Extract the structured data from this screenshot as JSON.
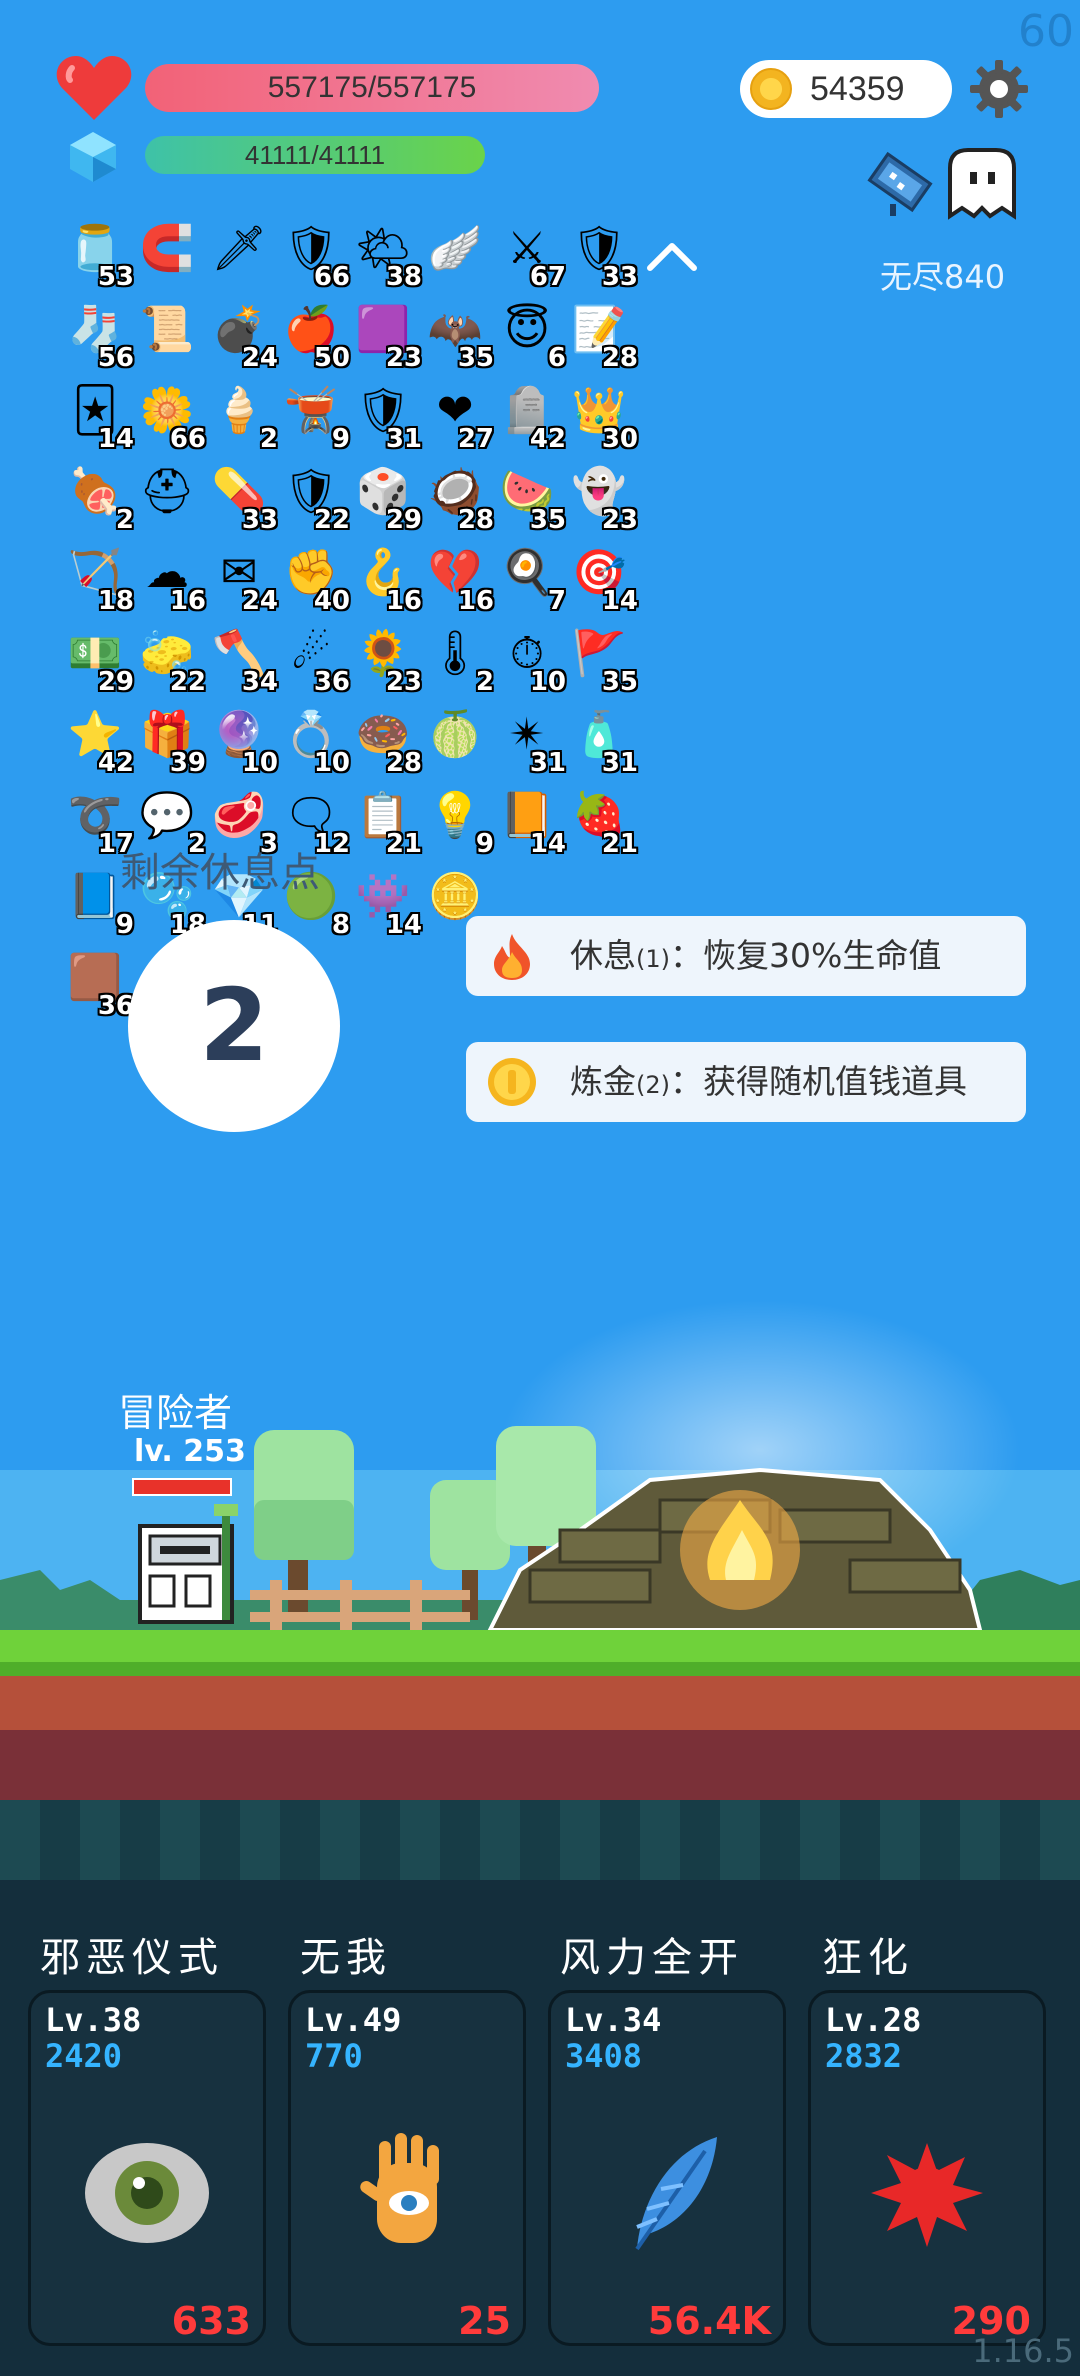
{
  "fps": "60",
  "version": "1.16.5",
  "hp": {
    "text": "557175/557175",
    "fraction": 1.0
  },
  "mp": {
    "text": "41111/41111",
    "fraction": 1.0
  },
  "gold": "54359",
  "endless_label": "无尽840",
  "items": [
    {
      "icon": "jar-icon",
      "glyph": "🫙",
      "count": "53"
    },
    {
      "icon": "magnet-icon",
      "glyph": "🧲",
      "count": ""
    },
    {
      "icon": "sword-icon",
      "glyph": "🗡",
      "count": ""
    },
    {
      "icon": "round-shield-icon",
      "glyph": "🛡",
      "count": "66"
    },
    {
      "icon": "sun-icon",
      "glyph": "🌤",
      "count": "38"
    },
    {
      "icon": "wing-icon",
      "glyph": "🪽",
      "count": ""
    },
    {
      "icon": "long-sword-icon",
      "glyph": "⚔",
      "count": "67"
    },
    {
      "icon": "shield-icon",
      "glyph": "🛡",
      "count": "33"
    },
    {
      "icon": "sock-icon",
      "glyph": "🧦",
      "count": "56"
    },
    {
      "icon": "scroll-icon",
      "glyph": "📜",
      "count": ""
    },
    {
      "icon": "grenade-icon",
      "glyph": "💣",
      "count": "24"
    },
    {
      "icon": "apple-icon",
      "glyph": "🍎",
      "count": "50"
    },
    {
      "icon": "purple-box-icon",
      "glyph": "🟪",
      "count": "23"
    },
    {
      "icon": "bat-icon",
      "glyph": "🦇",
      "count": "35"
    },
    {
      "icon": "halo-icon",
      "glyph": "😇",
      "count": "6"
    },
    {
      "icon": "note-icon",
      "glyph": "📝",
      "count": "28"
    },
    {
      "icon": "playing-cards-icon",
      "glyph": "🃏",
      "count": "14"
    },
    {
      "icon": "flower-icon",
      "glyph": "🌼",
      "count": "66"
    },
    {
      "icon": "ice-cream-icon",
      "glyph": "🍦",
      "count": "2"
    },
    {
      "icon": "cauldron-icon",
      "glyph": "🫕",
      "count": "9"
    },
    {
      "icon": "star-shield-icon",
      "glyph": "🛡",
      "count": "31"
    },
    {
      "icon": "heart-icon",
      "glyph": "❤",
      "count": "27"
    },
    {
      "icon": "tombstone-icon",
      "glyph": "🪦",
      "count": "42"
    },
    {
      "icon": "crown-icon",
      "glyph": "👑",
      "count": "30"
    },
    {
      "icon": "meat-icon",
      "glyph": "🍖",
      "count": "2"
    },
    {
      "icon": "helmet-icon",
      "glyph": "⛑",
      "count": ""
    },
    {
      "icon": "pill-icon",
      "glyph": "💊",
      "count": "33"
    },
    {
      "icon": "red-shield-icon",
      "glyph": "🛡",
      "count": "22"
    },
    {
      "icon": "dice-icon",
      "glyph": "🎲",
      "count": "29"
    },
    {
      "icon": "coconut-icon",
      "glyph": "🥥",
      "count": "28"
    },
    {
      "icon": "watermelon-icon",
      "glyph": "🍉",
      "count": "35"
    },
    {
      "icon": "ghost-icon",
      "glyph": "👻",
      "count": "23"
    },
    {
      "icon": "bow-icon",
      "glyph": "🏹",
      "count": "18"
    },
    {
      "icon": "cloud-icon",
      "glyph": "☁",
      "count": "16"
    },
    {
      "icon": "envelope-icon",
      "glyph": "✉",
      "count": "24"
    },
    {
      "icon": "fist-icon",
      "glyph": "✊",
      "count": "40"
    },
    {
      "icon": "hook-icon",
      "glyph": "🪝",
      "count": "16"
    },
    {
      "icon": "broken-heart-icon",
      "glyph": "💔",
      "count": "16"
    },
    {
      "icon": "fried-egg-icon",
      "glyph": "🍳",
      "count": "7"
    },
    {
      "icon": "target-icon",
      "glyph": "🎯",
      "count": "14"
    },
    {
      "icon": "cash-icon",
      "glyph": "💵",
      "count": "29"
    },
    {
      "icon": "eraser-icon",
      "glyph": "🧽",
      "count": "22"
    },
    {
      "icon": "battle-axe-icon",
      "glyph": "🪓",
      "count": "34"
    },
    {
      "icon": "meteor-icon",
      "glyph": "☄",
      "count": "36"
    },
    {
      "icon": "sunflower-icon",
      "glyph": "🌻",
      "count": "23"
    },
    {
      "icon": "thermometer-icon",
      "glyph": "🌡",
      "count": "2"
    },
    {
      "icon": "stopwatch-icon",
      "glyph": "⏱",
      "count": "10"
    },
    {
      "icon": "flag-icon",
      "glyph": "🚩",
      "count": "35"
    },
    {
      "icon": "star-card-icon",
      "glyph": "⭐",
      "count": "42"
    },
    {
      "icon": "gift-icon",
      "glyph": "🎁",
      "count": "39"
    },
    {
      "icon": "magic-orb-icon",
      "glyph": "🔮",
      "count": "10"
    },
    {
      "icon": "ring-icon",
      "glyph": "💍",
      "count": "10"
    },
    {
      "icon": "donut-icon",
      "glyph": "🍩",
      "count": "28"
    },
    {
      "icon": "lime-icon",
      "glyph": "🍈",
      "count": ""
    },
    {
      "icon": "spiked-ball-icon",
      "glyph": "✴",
      "count": "31"
    },
    {
      "icon": "potion-spray-icon",
      "glyph": "🧴",
      "count": "31"
    },
    {
      "icon": "noose-icon",
      "glyph": "➰",
      "count": "17"
    },
    {
      "icon": "speech-bubble-icon",
      "glyph": "💬",
      "count": "2"
    },
    {
      "icon": "steak-icon",
      "glyph": "🥩",
      "count": "3"
    },
    {
      "icon": "chat-icon",
      "glyph": "🗨",
      "count": "12"
    },
    {
      "icon": "clipboard-icon",
      "glyph": "📋",
      "count": "21"
    },
    {
      "icon": "light-bulb-icon",
      "glyph": "💡",
      "count": "9"
    },
    {
      "icon": "book-icon",
      "glyph": "📙",
      "count": "14"
    },
    {
      "icon": "strawberry-icon",
      "glyph": "🍓",
      "count": "21"
    },
    {
      "icon": "blue-scroll-icon",
      "glyph": "📘",
      "count": "9"
    },
    {
      "icon": "bubble-icon",
      "glyph": "🫧",
      "count": "18"
    },
    {
      "icon": "crystal-icon",
      "glyph": "💎",
      "count": "11"
    },
    {
      "icon": "green-spirit-icon",
      "glyph": "🟢",
      "count": "8"
    },
    {
      "icon": "goblin-icon",
      "glyph": "👾",
      "count": "14"
    },
    {
      "icon": "coin-stack-icon",
      "glyph": "🪙",
      "count": ""
    },
    {
      "icon": "pixel-card-icon",
      "glyph": "🟫",
      "count": "36"
    },
    {
      "icon": "glow-lamp-icon",
      "glyph": "🏮",
      "count": ""
    }
  ],
  "rest_points": {
    "label": "剩余休息点",
    "value": "2"
  },
  "actions": [
    {
      "icon": "fire-icon",
      "name": "休息",
      "paren": "(1)",
      "desc": "：恢复30%生命值"
    },
    {
      "icon": "gold-coin-icon",
      "name": "炼金",
      "paren": "(2)",
      "desc": "：获得随机值钱道具"
    }
  ],
  "hero": {
    "name": "冒险者",
    "level": "lv. 253",
    "hp_fraction": 1.0
  },
  "skills": [
    {
      "title": "邪恶仪式",
      "lv": "Lv.38",
      "points": "2420",
      "cost": "633",
      "icon": "eye-icon"
    },
    {
      "title": "无我",
      "lv": "Lv.49",
      "points": "770",
      "cost": "25",
      "icon": "hand-eye-icon"
    },
    {
      "title": "风力全开",
      "lv": "Lv.34",
      "points": "3408",
      "cost": "56.4K",
      "icon": "feather-icon"
    },
    {
      "title": "狂化",
      "lv": "Lv.28",
      "points": "2832",
      "cost": "290",
      "icon": "blood-splat-icon"
    }
  ]
}
